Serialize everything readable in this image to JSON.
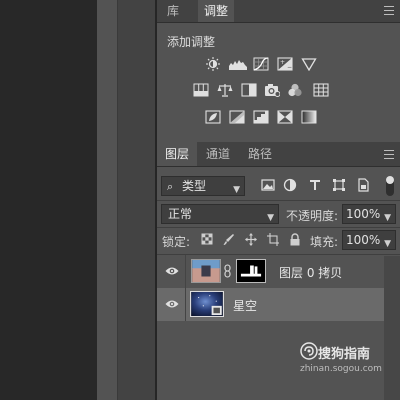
{
  "adjustments_panel": {
    "tabs": [
      {
        "label": "库",
        "active": false
      },
      {
        "label": "调整",
        "active": true
      }
    ],
    "title": "添加调整",
    "icons_row1": [
      "brightness-contrast-icon",
      "levels-icon",
      "curves-icon",
      "exposure-icon",
      "gradient-triangle-icon"
    ],
    "icons_row2": [
      "vibrance-icon",
      "color-balance-icon",
      "black-white-icon",
      "photo-filter-icon",
      "channel-mixer-icon",
      "color-lookup-icon"
    ],
    "icons_row3": [
      "invert-icon",
      "posterize-icon",
      "threshold-icon",
      "selective-color-icon",
      "gradient-map-icon"
    ]
  },
  "layers_panel": {
    "tabs": [
      {
        "label": "图层",
        "active": true
      },
      {
        "label": "通道",
        "active": false
      },
      {
        "label": "路径",
        "active": false
      }
    ],
    "filter": {
      "value": "类型"
    },
    "blend_mode": {
      "value": "正常"
    },
    "opacity": {
      "label": "不透明度:",
      "value": "100%"
    },
    "lock_label": "锁定:",
    "fill": {
      "label": "填充:",
      "value": "100%"
    },
    "layers": [
      {
        "name": "图层 0 拷贝",
        "selected": false,
        "has_mask": true
      },
      {
        "name": "星空",
        "selected": true,
        "has_mask": false
      }
    ]
  },
  "watermark": {
    "name": "搜狗指南",
    "url": "zhinan.sogou.com"
  }
}
